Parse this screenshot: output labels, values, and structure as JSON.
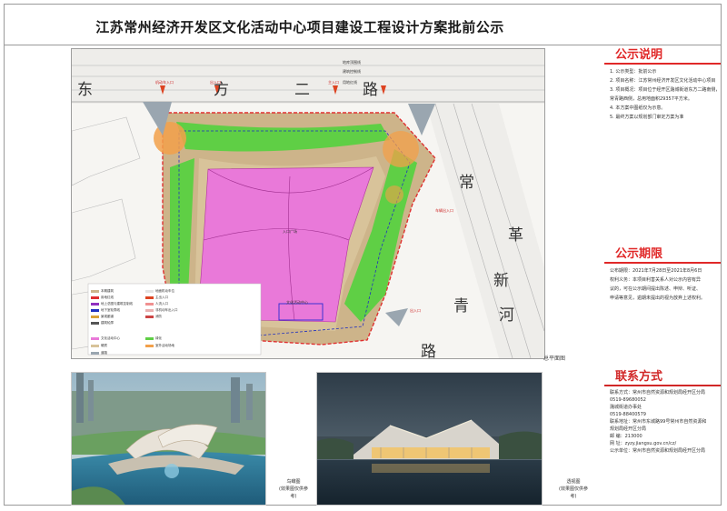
{
  "title": "江苏常州经济开发区文化活动中心项目建设工程设计方案批前公示",
  "plan": {
    "roads": {
      "east": [
        "东",
        "方",
        "二",
        "路"
      ],
      "changqing": [
        "常",
        "青",
        "路"
      ],
      "gexin": [
        "革",
        "新",
        "河"
      ]
    },
    "lines": [
      "地库顶围线",
      "建筑控制线",
      "用地红线"
    ],
    "labels": {
      "entry1": "机动车入口",
      "entry2": "出入口",
      "entry3": "车辆出入口",
      "main": "主入口",
      "plaza": "入口广场",
      "center": "文化活动中心"
    },
    "caption": "总平面图",
    "legend": [
      "本期建筑",
      "用地红线",
      "地上总图与建筑控制线",
      "地下室轮廓线",
      "景观廊道",
      "建筑轮廓",
      "地面机动车位",
      "主出入口",
      "人流入口",
      "非机动车出入口",
      "消防",
      "文化活动中心",
      "绿化",
      "硬质",
      "室外活动场地",
      "道路"
    ]
  },
  "notice": {
    "heading": "公示说明",
    "items": [
      "1. 公示类型：批前公示",
      "2. 项目名称：江苏常州经济开发区文化活动中心项目",
      "3. 项目概况：项目位于经开区潞城街道东方二路南侧，",
      "    常青路西侧，总用地面积29357平方米。",
      "4. 本方案中图纸仅为示意。",
      "5. 最终方案以规划部门审定方案为准"
    ]
  },
  "period": {
    "heading": "公示期限",
    "items": [
      "公布期限：2021年7月28日至2021年8月6日",
      "权利义务：本项目利害关系人对公示内容有异",
      "议的，可在公示期间提出陈述、申辩、听证、",
      "申请等意见，逾期未提出的视为放弃上述权利。"
    ]
  },
  "contact": {
    "heading": "联系方式",
    "items": [
      "联系方式：常州市自然资源和规划局经开区分局",
      "               0519-89680052",
      "               潞城街道办事处",
      "               0519-88400579",
      "联系地址：常州市东城路99号常州市自然资源和",
      "               规划局经开区分局",
      "邮    编：213000",
      "网    址：zyzy.jiangsu.gov.cn/cz/",
      "公示单位：常州市自然资源和规划局经开区分局"
    ]
  },
  "photos": {
    "bird_caption": [
      "鸟瞰图",
      "(效果图仅供参考)"
    ],
    "persp_caption": [
      "透视图",
      "(效果图仅供参考)"
    ]
  }
}
